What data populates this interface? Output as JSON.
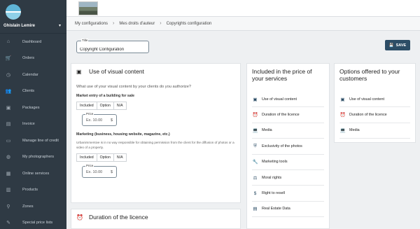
{
  "user": {
    "name": "Ghislain Lemire"
  },
  "nav": [
    {
      "label": "Dashboard",
      "icon": "home-icon",
      "glyph": "⌂"
    },
    {
      "label": "Orders",
      "icon": "cart-icon",
      "glyph": "🛒"
    },
    {
      "label": "Calendar",
      "icon": "clock-icon",
      "glyph": "◷"
    },
    {
      "label": "Clients",
      "icon": "users-icon",
      "glyph": "👥"
    },
    {
      "label": "Packages",
      "icon": "briefcase-icon",
      "glyph": "▣"
    },
    {
      "label": "Invoice",
      "icon": "file-icon",
      "glyph": "▤"
    },
    {
      "label": "Manage line of credit",
      "icon": "credit-card-icon",
      "glyph": "▭"
    },
    {
      "label": "My photographers",
      "icon": "photographer-icon",
      "glyph": "◍"
    },
    {
      "label": "Online services",
      "icon": "grid-icon",
      "glyph": "▦"
    },
    {
      "label": "Products",
      "icon": "product-icon",
      "glyph": "▥"
    },
    {
      "label": "Zones",
      "icon": "map-pin-icon",
      "glyph": "⚲"
    },
    {
      "label": "Special price lists",
      "icon": "tag-icon",
      "glyph": "✎"
    }
  ],
  "breadcrumb": [
    "My configurations",
    "Mes droits d'auteur",
    "Copyrights configuration"
  ],
  "title_field": {
    "legend": "Title",
    "value": "Copyright Configuration"
  },
  "save_label": "SAVE",
  "main": {
    "heading": "Use of visual content",
    "question": "What use of your visual content by your clients do you authorize?",
    "options": [
      "Included",
      "Option",
      "N/A"
    ],
    "price": {
      "legend": "Price",
      "placeholder": "Ex. 10.00",
      "currency": "$"
    },
    "field1": "Market entry of a building for sale",
    "field2": "Marketing (business, housing website, magazine, etc.)",
    "note": "Urbanimmersive is in no way responsible for obtaining permission from the client for the diffusion of photos or a video of a property."
  },
  "main2": {
    "heading": "Duration of the licence"
  },
  "included": {
    "title": "Included in the price of your services",
    "items": [
      {
        "label": "Use of visual content",
        "icon": "image-icon",
        "glyph": "▣"
      },
      {
        "label": "Duration of the licence",
        "icon": "alarm-clock-icon",
        "glyph": "⏰"
      },
      {
        "label": "Media",
        "icon": "laptop-icon",
        "glyph": "💻"
      },
      {
        "label": "Exclusivity of the photos",
        "icon": "shield-icon",
        "glyph": "⛨"
      },
      {
        "label": "Marketing tools",
        "icon": "wrench-icon",
        "glyph": "🔧"
      },
      {
        "label": "Moral rights",
        "icon": "gavel-icon",
        "glyph": "⚖"
      },
      {
        "label": "Right to resell",
        "icon": "dollar-icon",
        "glyph": "$"
      },
      {
        "label": "Real Estate Data",
        "icon": "database-icon",
        "glyph": "▤"
      }
    ]
  },
  "offered": {
    "title": "Options offered to your customers",
    "items": [
      {
        "label": "Use of visual content",
        "icon": "image-icon",
        "glyph": "▣"
      },
      {
        "label": "Duration of the licence",
        "icon": "alarm-clock-icon",
        "glyph": "⏰"
      },
      {
        "label": "Media",
        "icon": "laptop-icon",
        "glyph": "💻"
      }
    ]
  }
}
